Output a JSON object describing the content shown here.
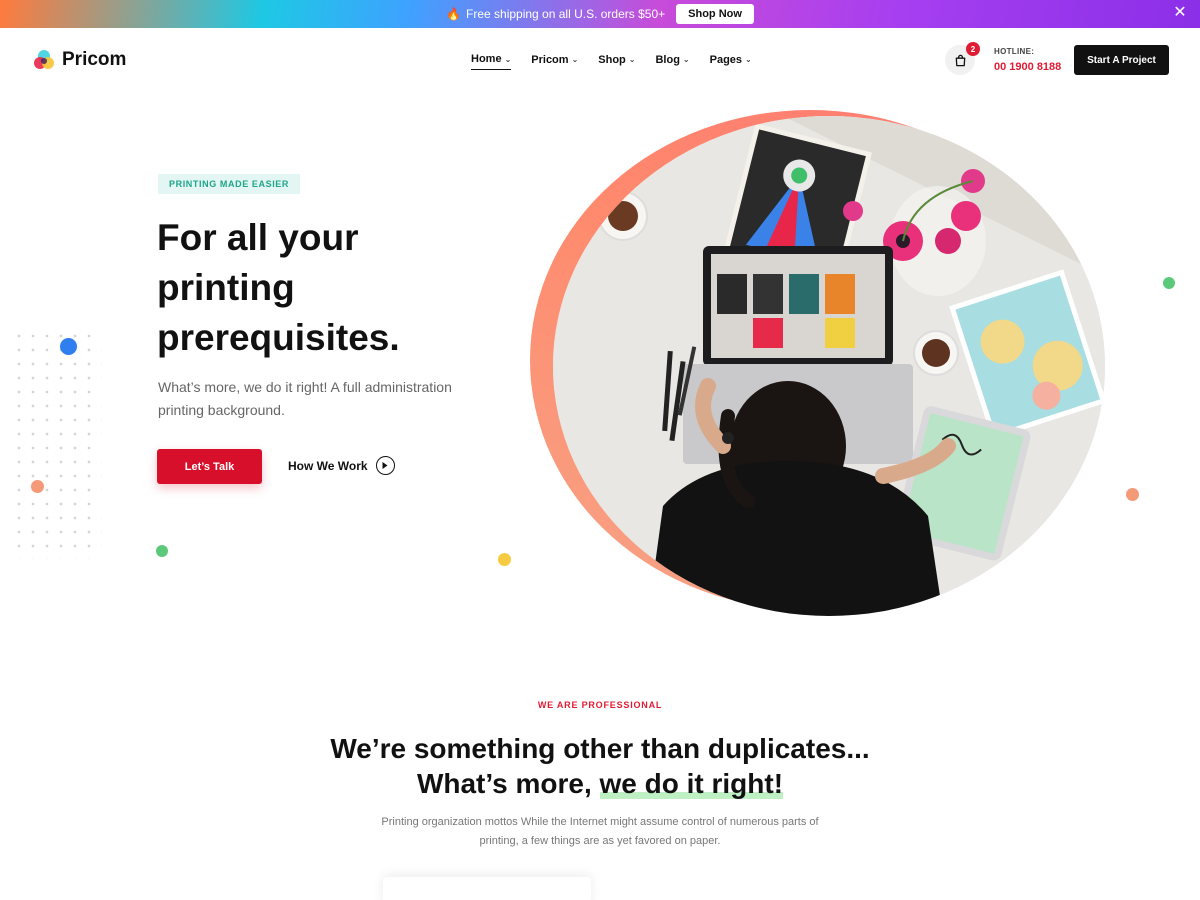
{
  "promo": {
    "text": "Free shipping on all U.S. orders $50+",
    "button": "Shop Now"
  },
  "header": {
    "logo": "Pricom",
    "nav": [
      {
        "label": "Home",
        "active": true
      },
      {
        "label": "Pricom"
      },
      {
        "label": "Shop"
      },
      {
        "label": "Blog"
      },
      {
        "label": "Pages"
      }
    ],
    "cart_count": "2",
    "hotline_label": "HOTLINE:",
    "hotline_number": "00 1900 8188",
    "cta": "Start A Project"
  },
  "hero": {
    "tag": "PRINTING MADE EASIER",
    "title_lines": [
      "For all your",
      "printing",
      "prerequisites."
    ],
    "subtitle": "What’s more, we do it right! A full administration printing background.",
    "primary_button": "Let’s Talk",
    "secondary_link": "How We Work"
  },
  "section": {
    "tag": "WE ARE PROFESSIONAL",
    "title_line1": "We’re something other than duplicates...",
    "title_line2_plain": "What’s more, ",
    "title_line2_highlight": "we do it right!",
    "description": "Printing organization mottos While the Internet might assume control of numerous parts of printing, a few things are as yet favored on paper."
  },
  "colors": {
    "accent_red": "#d70f2a",
    "tag_green": "#1fa58a",
    "highlight_green": "#bff0c4"
  }
}
